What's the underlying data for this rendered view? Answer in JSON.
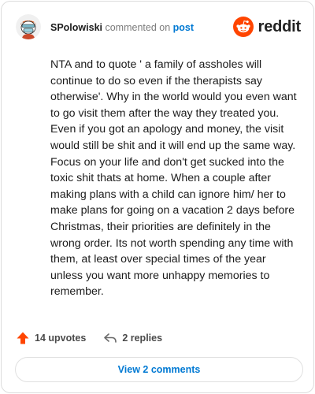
{
  "header": {
    "username": "SPolowiski",
    "commented_text": "commented on",
    "post_link": "post",
    "brand_word": "reddit"
  },
  "comment": {
    "body": "NTA and to quote ' a family of assholes will continue to do so even if the therapists say otherwise'. Why in the world would you even want to go visit them after the way they treated you. Even if you got an apology and money, the visit would still be shit and it will end up the same way. Focus on your life and don't get sucked into the toxic shit thats at home. When a couple after making plans with a child can ignore him/ her to make plans for going on a vacation 2 days before Christmas, their priorities are definitely in the wrong order. Its not worth spending any time with them, at least over special times of the year unless you want more unhappy memories to remember."
  },
  "actions": {
    "upvotes_label": "14 upvotes",
    "replies_label": "2 replies"
  },
  "footer": {
    "view_comments_label": "View 2 comments"
  },
  "colors": {
    "reddit_orange": "#ff4500",
    "link_blue": "#0079d3",
    "upvote_orange": "#ff4500"
  },
  "icons": {
    "avatar": "snoo-avatar",
    "brand": "reddit-logo-icon",
    "upvote": "upvote-arrow-icon",
    "reply": "reply-arrow-icon"
  }
}
